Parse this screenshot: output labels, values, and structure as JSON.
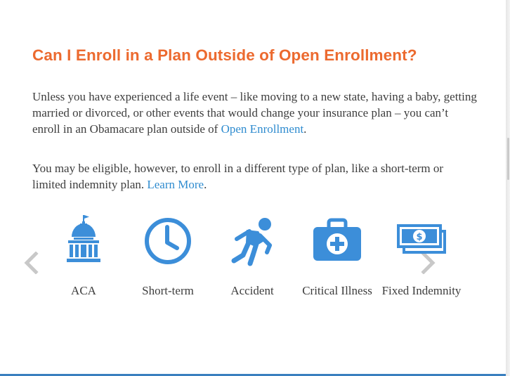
{
  "section": {
    "title": "Can I Enroll in a Plan Outside of Open Enrollment?",
    "p1_text": "Unless you have experienced a life event – like moving to a new state, having a baby, getting married or divorced, or other events that would change your insurance plan – you can’t enroll in an Obamacare plan outside of ",
    "p1_link": "Open Enrollment",
    "p1_end": ".",
    "p2_text": "You may be eligible, however, to enroll in a different type of plan, like a short-term or limited indemnity plan. ",
    "p2_link": "Learn More",
    "p2_end": "."
  },
  "carousel": {
    "prev_icon": "chevron-left-icon",
    "next_icon": "chevron-right-icon",
    "items": [
      {
        "label": "ACA",
        "icon": "capitol-building-icon"
      },
      {
        "label": "Short-term",
        "icon": "clock-icon"
      },
      {
        "label": "Accident",
        "icon": "falling-person-icon"
      },
      {
        "label": "Critical Illness",
        "icon": "medical-kit-icon"
      },
      {
        "label": "Fixed Indemnity",
        "icon": "cash-icon"
      }
    ]
  },
  "colors": {
    "title": "#ec6a2f",
    "link": "#2e8bcf",
    "icon": "#3c8ed9",
    "text": "#3d3d3d",
    "arrow": "#c8c8c8"
  }
}
